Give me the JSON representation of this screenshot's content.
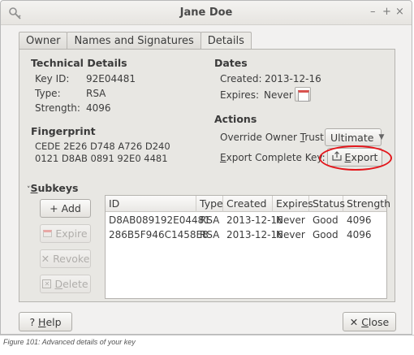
{
  "window": {
    "title": "Jane Doe",
    "min_label": "–",
    "max_label": "+",
    "close_label": "×"
  },
  "tabs": [
    {
      "label": "Owner"
    },
    {
      "label": "Names and Signatures"
    },
    {
      "label": "Details"
    }
  ],
  "technical": {
    "heading": "Technical Details",
    "keyid_label": "Key ID:",
    "keyid_value": "92E04481",
    "type_label": "Type:",
    "type_value": "RSA",
    "strength_label": "Strength:",
    "strength_value": "4096"
  },
  "dates": {
    "heading": "Dates",
    "created_label": "Created:",
    "created_value": "2013-12-16",
    "expires_label": "Expires:",
    "expires_value": "Never"
  },
  "fingerprint": {
    "heading": "Fingerprint",
    "line1": "CEDE 2E26 D748 A726 D240",
    "line2": "0121 D8AB 0891 92E0 4481"
  },
  "actions": {
    "heading": "Actions",
    "trust_label_pre": "Override Owner ",
    "trust_label_u": "T",
    "trust_label_post": "rust:",
    "trust_value": "Ultimate",
    "export_label_u": "E",
    "export_label_post": "xport Complete Key:",
    "export_button_u": "E",
    "export_button_post": "xport"
  },
  "subkeys": {
    "heading_u": "S",
    "heading_post": "ubkeys",
    "collapse_glyph": "˅",
    "add_label": "+ Add",
    "expire_label": "Expire",
    "revoke_label": "Revoke",
    "delete_u": "D",
    "delete_post": "elete",
    "columns": [
      "ID",
      "Type",
      "Created",
      "Expires",
      "Status",
      "Strength"
    ],
    "rows": [
      [
        "D8AB089192E04481",
        "RSA",
        "2013-12-16",
        "Never",
        "Good",
        "4096"
      ],
      [
        "286B5F946C1458E8",
        "RSA",
        "2013-12-16",
        "Never",
        "Good",
        "4096"
      ]
    ]
  },
  "footer": {
    "help_pre": "? ",
    "help_u": "H",
    "help_post": "elp",
    "close_pre": "✕ ",
    "close_u": "C",
    "close_post": "lose"
  },
  "caption": "Figure 101: Advanced details of your key",
  "colors": {
    "highlight": "#e4161b",
    "window_bg": "#f2f1f0",
    "panel_bg": "#e8e7e3"
  },
  "icons": [
    "key-icon",
    "calendar-icon",
    "export-icon",
    "pencil-icon",
    "revoke-icon",
    "delete-icon"
  ]
}
